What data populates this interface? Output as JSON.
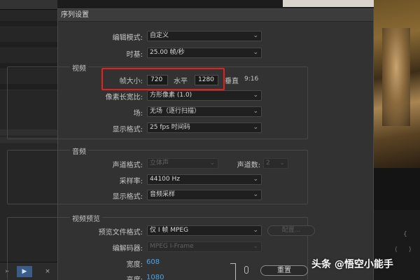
{
  "dialog": {
    "title": "序列设置",
    "editing_mode": {
      "label": "编辑模式:",
      "value": "自定义"
    },
    "timebase": {
      "label": "时基:",
      "value": "25.00 帧/秒"
    }
  },
  "video": {
    "section_title": "视频",
    "frame_size": {
      "label": "帧大小:",
      "width": "720",
      "horizontal_label": "水平",
      "height": "1280",
      "vertical_label": "垂直",
      "aspect": "9:16"
    },
    "pixel_aspect": {
      "label": "像素长宽比:",
      "value": "方形像素 (1.0)"
    },
    "fields": {
      "label": "场:",
      "value": "无场（逐行扫描）"
    },
    "display_format": {
      "label": "显示格式:",
      "value": "25 fps 时间码"
    }
  },
  "audio": {
    "section_title": "音频",
    "channel_format": {
      "label": "声道格式:",
      "value": "立体声"
    },
    "channel_count": {
      "label": "声道数:",
      "value": "2"
    },
    "sample_rate": {
      "label": "采样率:",
      "value": "44100 Hz"
    },
    "display_format": {
      "label": "显示格式:",
      "value": "音频采样"
    }
  },
  "preview": {
    "section_title": "视频预览",
    "file_format": {
      "label": "预览文件格式:",
      "value": "仅 I 帧 MPEG"
    },
    "configure_label": "配置...",
    "codec": {
      "label": "编解码器:",
      "value": "MPEG I-Frame"
    },
    "width": {
      "label": "宽度:",
      "value": "608"
    },
    "height": {
      "label": "高度:",
      "value": "1080"
    },
    "reset_label": "重置"
  },
  "background": {
    "bottom_buttons": [
      "»",
      "▶",
      "×"
    ]
  },
  "watermark": "头条 @悟空小能手",
  "colors": {
    "highlight": "#e8201c",
    "link_blue": "#4aa3e8"
  },
  "icons": {
    "dropdown": "chevron-down-icon",
    "link": "link-icon"
  }
}
